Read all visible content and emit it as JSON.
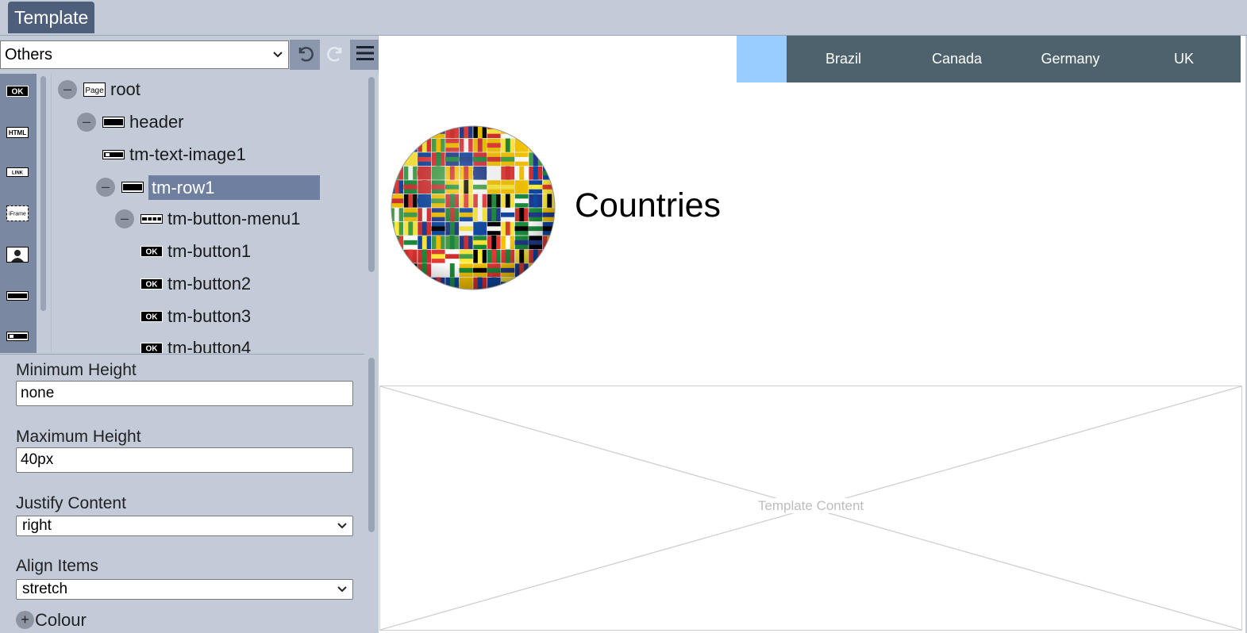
{
  "app": {
    "tab_label": "Template"
  },
  "toolbar": {
    "category": "Others"
  },
  "palette": [
    "ok",
    "html",
    "link",
    "iframe",
    "image",
    "row",
    "text-image"
  ],
  "tree": [
    {
      "label": "root",
      "icon": "page-icon",
      "toggle": "–"
    },
    {
      "label": "header",
      "icon": "row-icon",
      "toggle": "–"
    },
    {
      "label": "tm-text-image1",
      "icon": "text-image-icon",
      "toggle": ""
    },
    {
      "label": "tm-row1",
      "icon": "row-icon",
      "toggle": "–",
      "selected": true
    },
    {
      "label": "tm-button-menu1",
      "icon": "button-menu-icon",
      "toggle": "–"
    },
    {
      "label": "tm-button1",
      "icon": "ok-button-icon",
      "toggle": ""
    },
    {
      "label": "tm-button2",
      "icon": "ok-button-icon",
      "toggle": ""
    },
    {
      "label": "tm-button3",
      "icon": "ok-button-icon",
      "toggle": ""
    },
    {
      "label": "tm-button4",
      "icon": "ok-button-icon",
      "toggle": ""
    }
  ],
  "properties": {
    "min_height": {
      "label": "Minimum Height",
      "value": "none"
    },
    "max_height": {
      "label": "Maximum Height",
      "value": "40px"
    },
    "justify_content": {
      "label": "Justify Content",
      "value": "right"
    },
    "align_items": {
      "label": "Align Items",
      "value": "stretch"
    },
    "colour": {
      "label": "Colour",
      "toggle": "+"
    }
  },
  "preview": {
    "nav": [
      "Brazil",
      "Canada",
      "Germany",
      "UK"
    ],
    "title": "Countries",
    "content_placeholder": "Template Content",
    "colors": {
      "nav_bg": "#4d626d",
      "nav_spacer": "#99ccff"
    }
  }
}
